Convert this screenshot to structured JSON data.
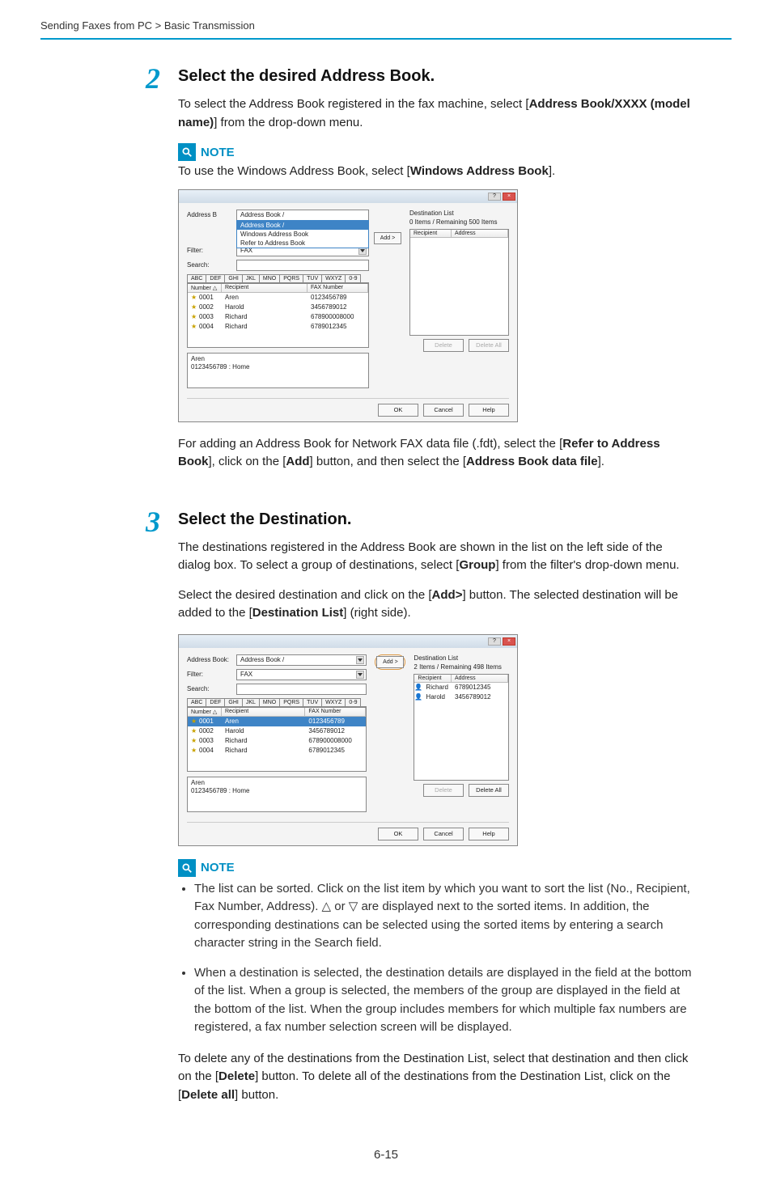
{
  "breadcrumb": "Sending Faxes from PC > Basic Transmission",
  "pageNumber": "6-15",
  "step2": {
    "num": "2",
    "title": "Select the desired Address Book.",
    "p1_a": "To select the Address Book registered in the fax machine, select [",
    "p1_b": "Address Book/XXXX (model name)",
    "p1_c": "] from the drop-down menu.",
    "note_label": "NOTE",
    "note_a": "To use the Windows Address Book, select [",
    "note_b": "Windows Address Book",
    "note_c": "].",
    "p2_a": "For adding an Address Book for Network FAX data file (.fdt), select the [",
    "p2_b": "Refer to Address Book",
    "p2_c": "], click on the [",
    "p2_d": "Add",
    "p2_e": "] button, and then select the [",
    "p2_f": "Address Book data file",
    "p2_g": "]."
  },
  "step3": {
    "num": "3",
    "title": "Select the Destination.",
    "p1_a": "The destinations registered in the Address Book are shown in the list on the left side of the dialog box. To select a group of destinations, select [",
    "p1_b": "Group",
    "p1_c": "] from the filter's drop-down menu.",
    "p2_a": "Select the desired destination and click on the [",
    "p2_b": "Add>",
    "p2_c": "] button. The selected destination will be added to the [",
    "p2_d": "Destination List",
    "p2_e": "] (right side).",
    "note_label": "NOTE",
    "bullet1": "The list can be sorted. Click on the list item by which you want to sort the list (No., Recipient, Fax Number, Address). △ or ▽ are displayed next to the sorted items. In addition, the corresponding destinations can be selected using the sorted items by entering a search character string in the Search field.",
    "bullet2": "When a destination is selected, the destination details are displayed in the field at the bottom of the list. When a group is selected, the members of the group are displayed in the field at the bottom of the list. When the group includes members for which multiple fax numbers are registered, a fax number selection screen will be displayed.",
    "p3_a": "To delete any of the destinations from the Destination List, select that destination and then click on the [",
    "p3_b": "Delete",
    "p3_c": "] button. To delete all of the destinations from the Destination List, click on the [",
    "p3_d": "Delete all",
    "p3_e": "] button."
  },
  "dlg": {
    "addr_label": "Address B",
    "addr_label2": "Address Book:",
    "addr_value": "Address Book /",
    "dd_opt1": "Address Book /",
    "dd_opt2": "Windows Address Book",
    "dd_opt3": "Refer to Address Book",
    "filter_label": "Filter:",
    "filter_value": "FAX",
    "search_label": "Search:",
    "tabs": [
      "ABC",
      "DEF",
      "GHI",
      "JKL",
      "MNO",
      "PQRS",
      "TUV",
      "WXYZ",
      "0-9"
    ],
    "col_num": "Number △",
    "col_rec": "Recipient",
    "col_fax": "FAX Number",
    "col_addr": "Address",
    "rows": [
      {
        "no": "0001",
        "name": "Aren",
        "fax": "0123456789"
      },
      {
        "no": "0002",
        "name": "Harold",
        "fax": "3456789012"
      },
      {
        "no": "0003",
        "name": "Richard",
        "fax": "678900008000"
      },
      {
        "no": "0004",
        "name": "Richard",
        "fax": "6789012345"
      }
    ],
    "detail_name": "Aren",
    "detail_line": "0123456789 : Home",
    "dest_title": "Destination List",
    "dest_sub1": "0 Items / Remaining 500 Items",
    "dest_sub2": "2 Items / Remaining 498 Items",
    "dest_rows": [
      {
        "name": "Richard",
        "addr": "6789012345"
      },
      {
        "name": "Harold",
        "addr": "3456789012"
      }
    ],
    "add": "Add >",
    "delete": "Delete",
    "delete_all": "Delete All",
    "ok": "OK",
    "cancel": "Cancel",
    "help": "Help"
  }
}
